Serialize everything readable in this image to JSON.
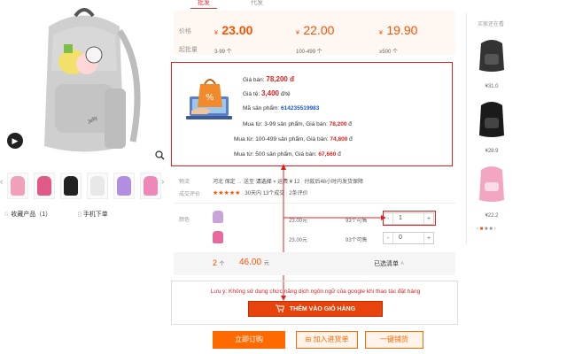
{
  "tabs": [
    {
      "label": "批发"
    },
    {
      "label": "代发"
    }
  ],
  "price_table": {
    "price_label": "价格",
    "qty_label": "起批量",
    "tiers": [
      {
        "currency": "¥",
        "price": "23.00",
        "range": "3-99 个"
      },
      {
        "currency": "¥",
        "price": "22.00",
        "range": "100-499 个"
      },
      {
        "currency": "¥",
        "price": "19.90",
        "range": "≥500 个"
      }
    ]
  },
  "popup": {
    "line1_label": "Giá bán:",
    "line1_value": "78,200 đ",
    "line2_label": "Giá tệ:",
    "line2_value": "3,400",
    "line2_unit": "đ/tệ",
    "line3_label": "Mã sản phẩm:",
    "line3_value": "614235519983",
    "line4_label": "Mua từ: 3-99 sản phẩm, Giá bán:",
    "line4_value": "78,200",
    "line4_unit": "đ",
    "line5_label": "Mua từ: 100-499 sản phẩm, Giá bán:",
    "line5_value": "74,800",
    "line5_unit": "đ",
    "line6_label": "Mua từ: 500 sản phẩm, Giá bán:",
    "line6_value": "67,660",
    "line6_unit": "đ"
  },
  "shipping": {
    "label1": "物流",
    "from": "河北 保定",
    "to_prefix": "送至",
    "to_value": "请选择",
    "fee": "运费 ¥ 12",
    "note": "付款后48小时内发货保障",
    "label2": "成交评价",
    "stars": "★★★★★",
    "sold": "30天内 13个成交",
    "reviews": "2条评价"
  },
  "variants": {
    "label": "颜色",
    "rows": [
      {
        "price": "23.00元",
        "stock": "93个可售",
        "qty": "1",
        "swatch": "#c9a4d9"
      },
      {
        "price": "23.00元",
        "stock": "93个可售",
        "qty": "0",
        "swatch": "#e66aa0"
      }
    ]
  },
  "totals": {
    "count": "2",
    "count_unit": "个",
    "amount": "46.00",
    "amount_unit": "元",
    "selected": "已选清单"
  },
  "notice": {
    "text": "Lưu ý: Không sử dụng chức năng dịch ngôn ngữ của google khi thao tác đặt hàng",
    "cart_button": "THÊM VÀO GIỎ HÀNG"
  },
  "actions": {
    "buy": "立即订购",
    "stock": "加入进货单",
    "distribute": "一键铺货"
  },
  "gallery": {
    "favorite": "收藏产品（1）",
    "mobile": "手机下单",
    "thumb_colors": [
      "#f0a0b8",
      "#e05a85",
      "#222222",
      "#e8e8e8",
      "#b28ee0",
      "#ee88b8"
    ]
  },
  "sidebar": {
    "title": "买家还在看",
    "items": [
      {
        "price": "¥31.0",
        "color": "#333333"
      },
      {
        "price": "¥28.9",
        "color": "#1a1a1a"
      },
      {
        "price": "¥22.2",
        "color": "#f3a6c2"
      }
    ]
  },
  "colors": {
    "accent": "#ff5000",
    "popup_border": "#e02020",
    "cart_button": "#e8430c"
  }
}
